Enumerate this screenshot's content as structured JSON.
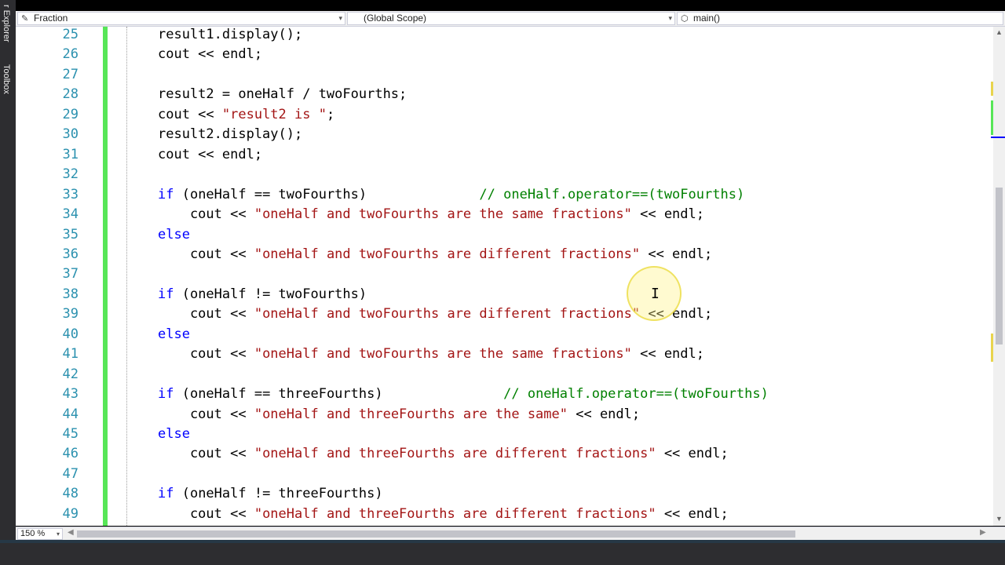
{
  "side_tabs": [
    "r Explorer",
    "Toolbox"
  ],
  "navbar": {
    "project": "Fraction",
    "scope": "(Global Scope)",
    "member": "main()"
  },
  "editor": {
    "lines": [
      {
        "n": "25",
        "html": "result1.display();"
      },
      {
        "n": "26",
        "html": "cout << endl;"
      },
      {
        "n": "27",
        "html": ""
      },
      {
        "n": "28",
        "html": "result2 = oneHalf / twoFourths;"
      },
      {
        "n": "29",
        "html": "cout << <s>\"result2 is \"</s>;"
      },
      {
        "n": "30",
        "html": "result2.display();"
      },
      {
        "n": "31",
        "html": "cout << endl;"
      },
      {
        "n": "32",
        "html": ""
      },
      {
        "n": "33",
        "html": "<k>if</k> (oneHalf == twoFourths)              <c>// oneHalf.operator==(twoFourths)</c>"
      },
      {
        "n": "34",
        "html": "    cout << <s>\"oneHalf and twoFourths are the same fractions\"</s> << endl;"
      },
      {
        "n": "35",
        "html": "<k>else</k>"
      },
      {
        "n": "36",
        "html": "    cout << <s>\"oneHalf and twoFourths are different fractions\"</s> << endl;"
      },
      {
        "n": "37",
        "html": ""
      },
      {
        "n": "38",
        "html": "<k>if</k> (oneHalf != twoFourths)"
      },
      {
        "n": "39",
        "html": "    cout << <s>\"oneHalf and twoFourths are different fractions\"</s> << endl;"
      },
      {
        "n": "40",
        "html": "<k>else</k>"
      },
      {
        "n": "41",
        "html": "    cout << <s>\"oneHalf and twoFourths are the same fractions\"</s> << endl;"
      },
      {
        "n": "42",
        "html": ""
      },
      {
        "n": "43",
        "html": "<k>if</k> (oneHalf == threeFourths)               <c>// oneHalf.operator==(twoFourths)</c>"
      },
      {
        "n": "44",
        "html": "    cout << <s>\"oneHalf and threeFourths are the same\"</s> << endl;"
      },
      {
        "n": "45",
        "html": "<k>else</k>"
      },
      {
        "n": "46",
        "html": "    cout << <s>\"oneHalf and threeFourths are different fractions\"</s> << endl;"
      },
      {
        "n": "47",
        "html": ""
      },
      {
        "n": "48",
        "html": "<k>if</k> (oneHalf != threeFourths)"
      },
      {
        "n": "49",
        "html": "    cout << <s>\"oneHalf and threeFourths are different fractions\"</s> << endl;"
      }
    ]
  },
  "zoom": "150 %",
  "colors": {
    "keyword": "#0000ff",
    "string": "#a31515",
    "comment": "#008000",
    "line_number": "#2b91af",
    "change_bar": "#57e657"
  }
}
